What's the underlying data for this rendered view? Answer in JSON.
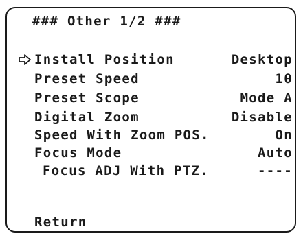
{
  "menu": {
    "title": "### Other 1/2 ###",
    "items": [
      {
        "label": "Install Position",
        "value": "Desktop",
        "selected": true
      },
      {
        "label": "Preset Speed",
        "value": "10"
      },
      {
        "label": "Preset Scope",
        "value": "Mode A"
      },
      {
        "label": "Digital Zoom",
        "value": "Disable"
      },
      {
        "label": "Speed With Zoom POS.",
        "value": "On"
      },
      {
        "label": "Focus Mode",
        "value": "Auto"
      },
      {
        "label": "Focus ADJ With PTZ.",
        "value": "----",
        "sub": true
      }
    ],
    "return_label": "Return",
    "cursor_icon": "right-arrow-cursor-icon"
  }
}
